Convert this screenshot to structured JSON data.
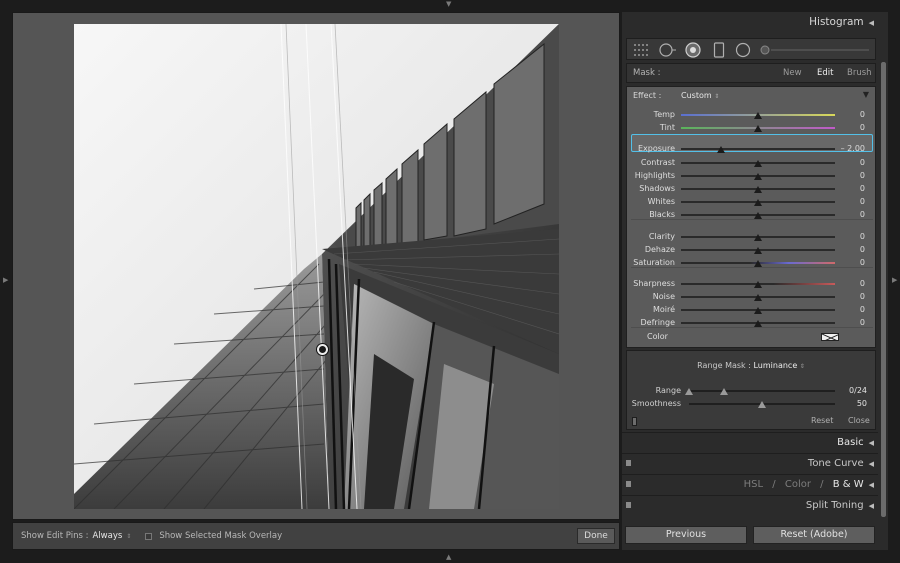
{
  "photo": {
    "subject": "building"
  },
  "bottom_bar": {
    "show_edit_pins_label": "Show Edit Pins :",
    "show_edit_pins_value": "Always",
    "updown": "⇕",
    "overlay_label": "Show Selected Mask Overlay",
    "done_label": "Done"
  },
  "panel": {
    "histogram_title": "Histogram",
    "collapse_glyph": "◀",
    "tools": [
      "grid-dots-icon",
      "circle-gradient-icon",
      "radial-filter-icon",
      "graduated-filter-icon",
      "circle-outline-icon",
      "brush-slider-icon"
    ],
    "mask": {
      "label": "Mask :",
      "options": [
        "New",
        "Edit",
        "Brush"
      ],
      "active": "Edit"
    },
    "effect": {
      "label": "Effect :",
      "value": "Custom",
      "updown": "⇕",
      "expand_glyph": "▼"
    },
    "sliders": [
      {
        "label": "Temp",
        "value": "0",
        "pos": 0.5
      },
      {
        "label": "Tint",
        "value": "0",
        "pos": 0.5
      },
      {
        "label": "Exposure",
        "value": "– 2.00",
        "pos": 0.26
      },
      {
        "label": "Contrast",
        "value": "0",
        "pos": 0.5
      },
      {
        "label": "Highlights",
        "value": "0",
        "pos": 0.5
      },
      {
        "label": "Shadows",
        "value": "0",
        "pos": 0.5
      },
      {
        "label": "Whites",
        "value": "0",
        "pos": 0.5
      },
      {
        "label": "Blacks",
        "value": "0",
        "pos": 0.5
      },
      {
        "label": "Clarity",
        "value": "0",
        "pos": 0.5
      },
      {
        "label": "Dehaze",
        "value": "0",
        "pos": 0.5
      },
      {
        "label": "Saturation",
        "value": "0",
        "pos": 0.5
      },
      {
        "label": "Sharpness",
        "value": "0",
        "pos": 0.5
      },
      {
        "label": "Noise",
        "value": "0",
        "pos": 0.5
      },
      {
        "label": "Moiré",
        "value": "0",
        "pos": 0.5
      },
      {
        "label": "Defringe",
        "value": "0",
        "pos": 0.5
      }
    ],
    "color_label": "Color",
    "range_mask": {
      "label": "Range Mask :",
      "value": "Luminance",
      "updown": "⇕",
      "range_label": "Range",
      "range_value": "0/24",
      "smoothness_label": "Smoothness",
      "smoothness_value": "50",
      "smoothness_pos": 0.5
    },
    "reset_label": "Reset",
    "close_label": "Close",
    "sections": {
      "basic": "Basic",
      "tone_curve": "Tone Curve",
      "hsl": "HSL",
      "color": "Color",
      "bw": "B & W",
      "slash": "/",
      "split_toning": "Split Toning"
    },
    "previous_label": "Previous",
    "reset_adobe_label": "Reset (Adobe)"
  },
  "colors": {
    "highlight": "#53c0e8",
    "temp_gradient": [
      "#5a6fd0",
      "#d8d85a"
    ],
    "tint_gradient": [
      "#5ab55a",
      "#c05ac8"
    ]
  }
}
